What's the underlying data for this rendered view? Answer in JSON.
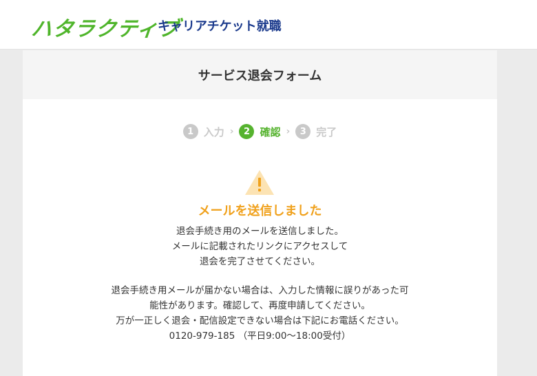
{
  "header": {
    "logo_main": "ハタラクティブ",
    "logo_sub": "キャリアチケット就職"
  },
  "panel": {
    "title": "サービス退会フォーム"
  },
  "steps": [
    {
      "num": "1",
      "label": "入力",
      "active": false
    },
    {
      "num": "2",
      "label": "確認",
      "active": true
    },
    {
      "num": "3",
      "label": "完了",
      "active": false
    }
  ],
  "step_separator": "›",
  "message": {
    "icon": "warning-triangle-icon",
    "heading": "メールを送信しました",
    "lines_1": [
      "退会手続き用のメールを送信しました。",
      "メールに記載されたリンクにアクセスして",
      "退会を完了させてください。"
    ],
    "lines_2": [
      "退会手続き用メールが届かない場合は、入力した情報に誤りがあった可能性があります。確認して、再度申請してください。",
      "万が一正しく退会・配信設定できない場合は下記にお電話ください。"
    ],
    "phone": "0120-979-185",
    "hours": "（平日9:00〜18:00受付）"
  },
  "colors": {
    "accent_green": "#56b32f",
    "warning_orange": "#f0a11c",
    "brand_navy": "#1b3a8c"
  }
}
